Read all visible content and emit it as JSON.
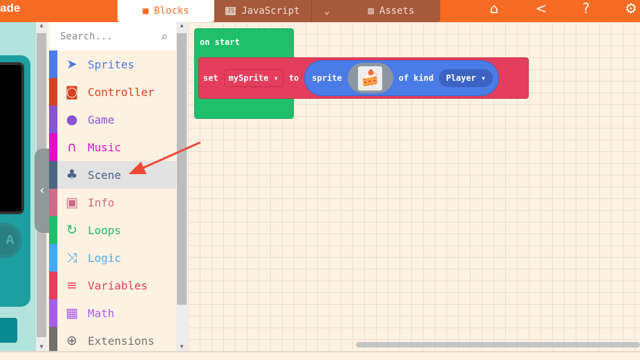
{
  "header": {
    "brand": "ade",
    "tabs": [
      {
        "label": "Blocks",
        "icon": "puzzle-icon"
      },
      {
        "label": "JavaScript",
        "icon": "js-icon"
      },
      {
        "label": "Assets",
        "icon": "image-icon"
      }
    ],
    "icons": [
      "home-icon",
      "share-icon",
      "help-icon",
      "settings-icon"
    ]
  },
  "simulator": {
    "button_a": "A"
  },
  "toolbox": {
    "search_placeholder": "Search...",
    "items": [
      {
        "label": "Sprites",
        "color": "#4a7be6",
        "icon": "paper-plane-icon"
      },
      {
        "label": "Controller",
        "color": "#d54322",
        "icon": "gamepad-icon"
      },
      {
        "label": "Game",
        "color": "#8854d0",
        "icon": "circle-icon"
      },
      {
        "label": "Music",
        "color": "#e30fc0",
        "icon": "headphones-icon"
      },
      {
        "label": "Scene",
        "color": "#4b6584",
        "icon": "tree-icon"
      },
      {
        "label": "Info",
        "color": "#cf6a87",
        "icon": "id-card-icon"
      },
      {
        "label": "Loops",
        "color": "#20bf6b",
        "icon": "redo-icon"
      },
      {
        "label": "Logic",
        "color": "#45aaf2",
        "icon": "shuffle-icon"
      },
      {
        "label": "Variables",
        "color": "#e53e5c",
        "icon": "list-icon"
      },
      {
        "label": "Math",
        "color": "#a55eea",
        "icon": "calculator-icon"
      },
      {
        "label": "Extensions",
        "color": "#717171",
        "icon": "plus-circle-icon"
      }
    ]
  },
  "workspace": {
    "on_start": "on start",
    "set": "set",
    "variable": "mySprite",
    "to": "to",
    "sprite": "sprite",
    "of_kind": "of kind",
    "kind": "Player"
  }
}
